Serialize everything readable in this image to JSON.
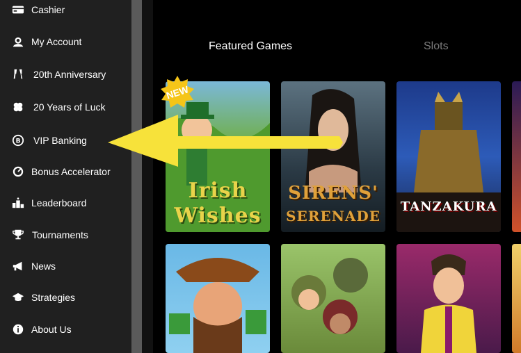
{
  "sidebar": {
    "items": [
      {
        "label": "Cashier",
        "icon": "wallet-icon"
      },
      {
        "label": "My Account",
        "icon": "user-icon"
      },
      {
        "label": "20th Anniversary",
        "icon": "champagne-icon"
      },
      {
        "label": "20 Years of Luck",
        "icon": "clover-icon"
      },
      {
        "label": "VIP Banking",
        "icon": "bitcoin-icon"
      },
      {
        "label": "Bonus Accelerator",
        "icon": "speedometer-icon"
      },
      {
        "label": "Leaderboard",
        "icon": "podium-icon"
      },
      {
        "label": "Tournaments",
        "icon": "trophy-icon"
      },
      {
        "label": "News",
        "icon": "megaphone-icon"
      },
      {
        "label": "Strategies",
        "icon": "graduation-cap-icon"
      },
      {
        "label": "About Us",
        "icon": "info-icon"
      }
    ]
  },
  "tabs": [
    {
      "label": "Featured Games",
      "active": true
    },
    {
      "label": "Slots",
      "active": false
    }
  ],
  "games": [
    {
      "title_line1": "Irish",
      "title_line2": "Wishes",
      "badge": "NEW"
    },
    {
      "title_line1": "SIRENS'",
      "title_line2": "SERENADE"
    },
    {
      "title_line1": "TANZAKURA",
      "title_line2": ""
    },
    {
      "title_line1": "",
      "title_line2": ""
    },
    {
      "title_line1": "",
      "title_line2": ""
    },
    {
      "title_line1": "",
      "title_line2": ""
    }
  ],
  "colors": {
    "sidebar_bg": "#202020",
    "tab_active": "#ffffff",
    "tab_inactive": "#7a7a7a",
    "arrow": "#f7e23a",
    "badge": "#f5c518"
  }
}
